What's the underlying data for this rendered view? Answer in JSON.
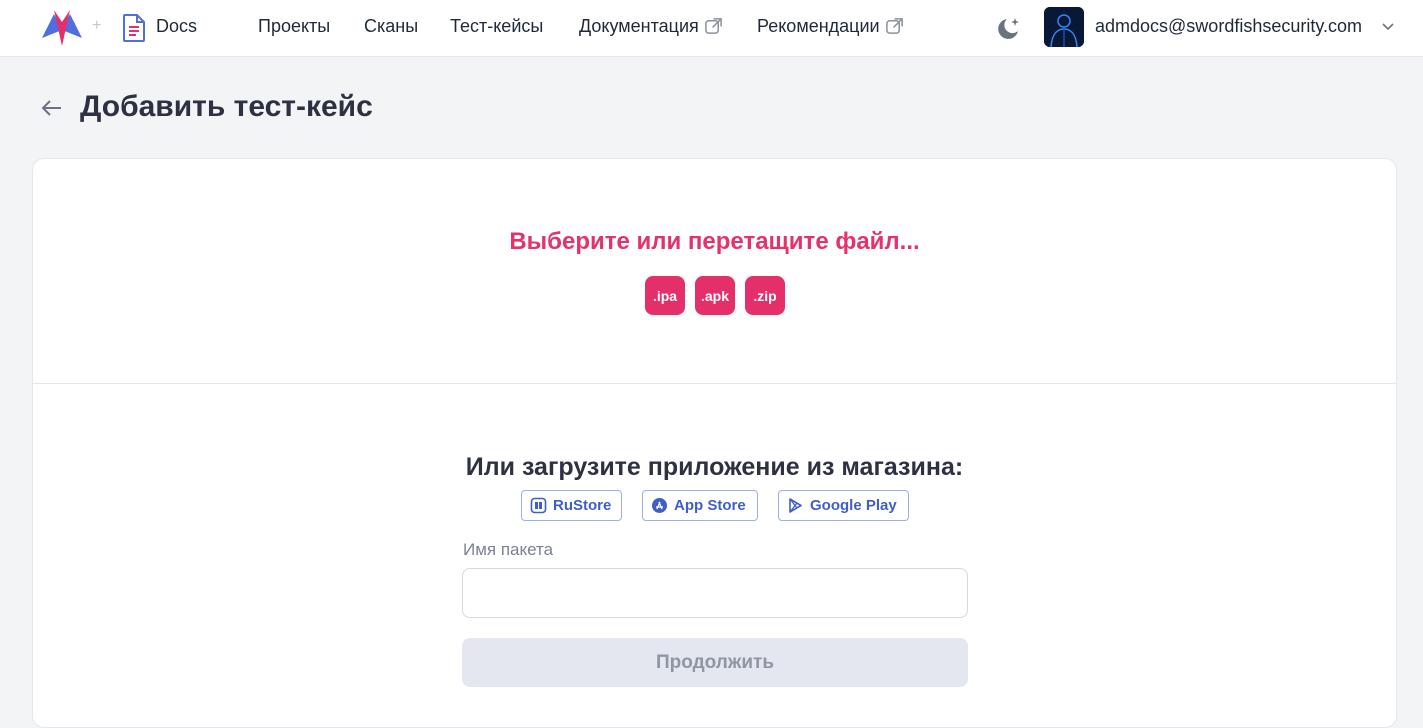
{
  "header": {
    "plus_sign": "+",
    "app_label": "Docs",
    "nav": [
      "Проекты",
      "Сканы",
      "Тест-кейсы",
      "Документация",
      "Рекомендации"
    ],
    "user_email": "admdocs@swordfishsecurity.com"
  },
  "page": {
    "title": "Добавить тест-кейс"
  },
  "upload": {
    "title": "Выберите или перетащите файл...",
    "extensions": [
      ".ipa",
      ".apk",
      ".zip"
    ]
  },
  "store": {
    "title": "Или загрузите приложение из магазина:",
    "buttons": [
      "RuStore",
      "App Store",
      "Google Play"
    ],
    "package_label": "Имя пакета",
    "package_value": "",
    "continue_label": "Продолжить"
  },
  "colors": {
    "accent_pink": "#e52f6a",
    "store_blue": "#3f5fc7",
    "disabled_bg": "#e4e7ef"
  }
}
